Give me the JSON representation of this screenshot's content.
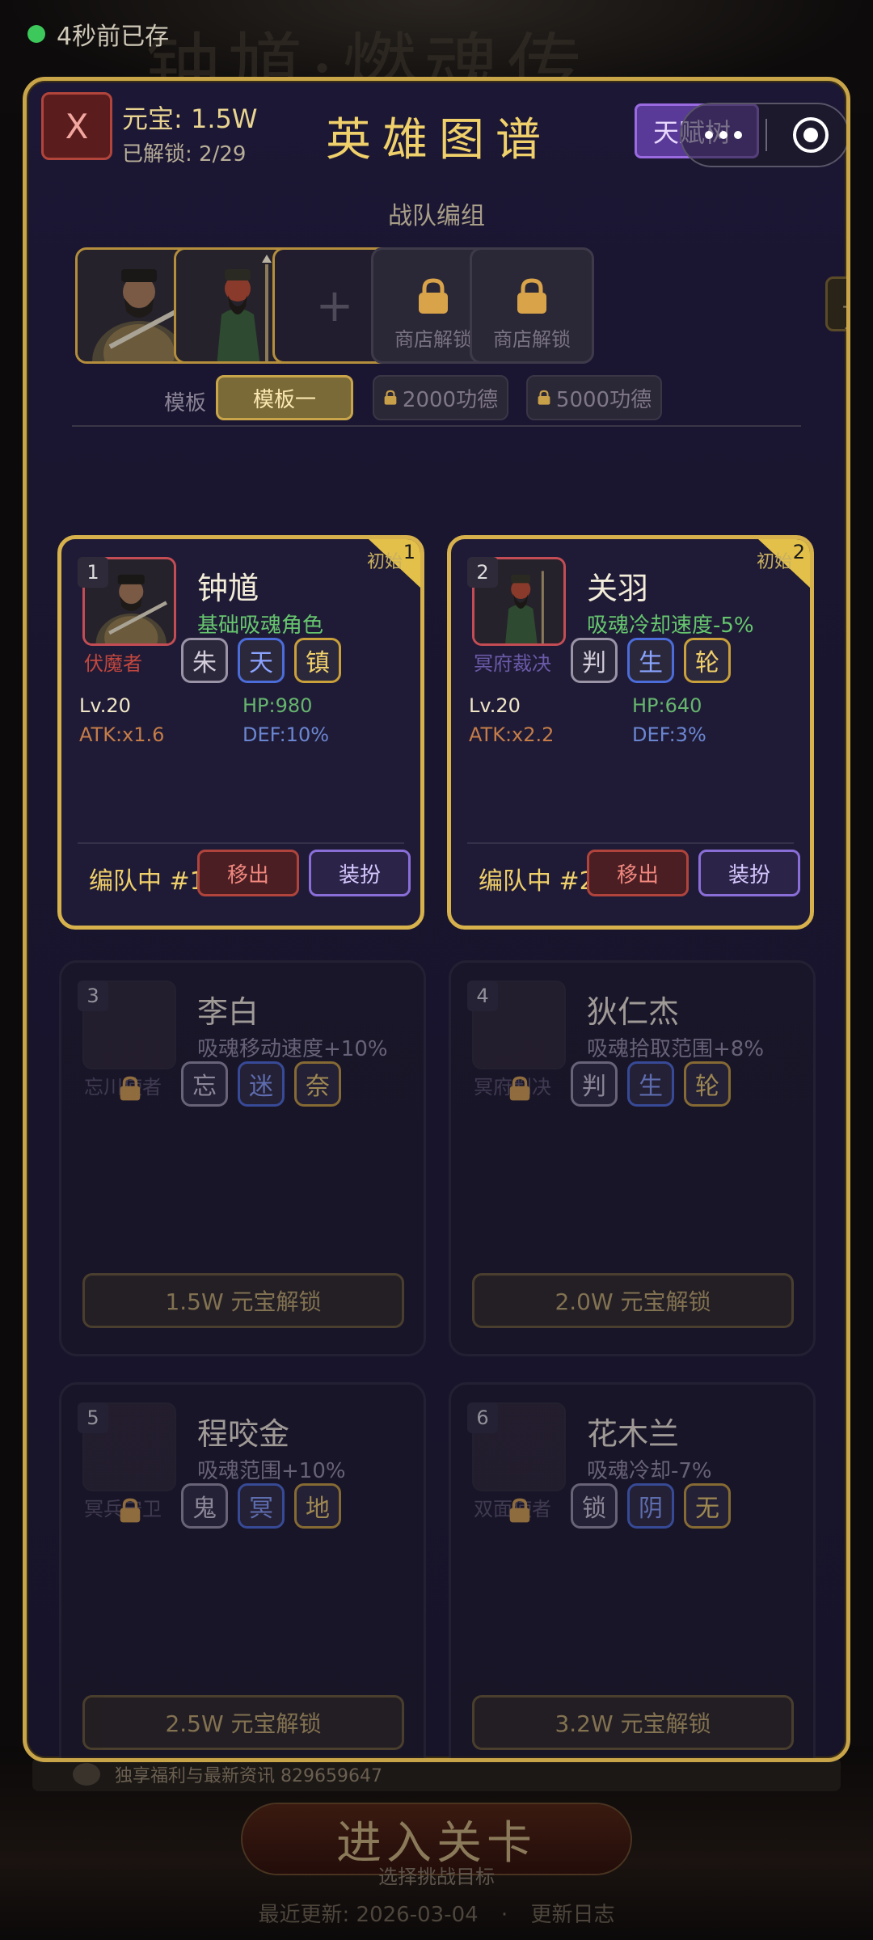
{
  "status": {
    "text": "4秒前已存"
  },
  "background": {
    "title": "钟馗·燃魂传",
    "notice": "独享福利与最新资讯 829659647",
    "enter_button": "进入关卡",
    "enter_sub": "选择挑战目标",
    "update_label": "最近更新: 2026-03-04",
    "update_sep": "·",
    "changelog": "更新日志"
  },
  "header": {
    "close_label": "X",
    "currency": "元宝: 1.5W",
    "unlocked": "已解锁: 2/29",
    "title": "英雄图谱",
    "talent_label": "天赋树"
  },
  "team": {
    "title": "战队编组",
    "slot_locked_label": "商店解锁",
    "slot_empty_label": "+",
    "side_label": "一键",
    "template_label": "模板",
    "templates": [
      {
        "label": "模板一",
        "active": true
      },
      {
        "label": "2000功德",
        "active": false
      },
      {
        "label": "5000功德",
        "active": false
      }
    ]
  },
  "heroes": [
    {
      "index": "1",
      "name": "钟馗",
      "skill": "基础吸魂角色",
      "role": "伏魔者",
      "tags": [
        "朱",
        "天",
        "镇"
      ],
      "tag_styles": [
        "gray",
        "blue",
        "gold"
      ],
      "level": "Lv.20",
      "hp": "HP:980",
      "atk": "ATK:x1.6",
      "def": "DEF:10%",
      "badge": "初始",
      "corner": "1",
      "team_status": "编队中 #1",
      "remove_label": "移出",
      "equip_label": "装扮",
      "unlocked": true
    },
    {
      "index": "2",
      "name": "关羽",
      "skill": "吸魂冷却速度-5%",
      "role": "冥府裁决",
      "tags": [
        "判",
        "生",
        "轮"
      ],
      "tag_styles": [
        "gray",
        "blue",
        "gold"
      ],
      "level": "Lv.20",
      "hp": "HP:640",
      "atk": "ATK:x2.2",
      "def": "DEF:3%",
      "badge": "初始",
      "corner": "2",
      "team_status": "编队中 #2",
      "remove_label": "移出",
      "equip_label": "装扮",
      "unlocked": true
    },
    {
      "index": "3",
      "name": "李白",
      "skill": "吸魂移动速度+10%",
      "role": "忘川使者",
      "tags": [
        "忘",
        "迷",
        "奈"
      ],
      "tag_styles": [
        "gray",
        "blue",
        "gold"
      ],
      "unlock_label": "1.5W 元宝解锁",
      "unlocked": false
    },
    {
      "index": "4",
      "name": "狄仁杰",
      "skill": "吸魂拾取范围+8%",
      "role": "冥府判决",
      "tags": [
        "判",
        "生",
        "轮"
      ],
      "tag_styles": [
        "gray",
        "blue",
        "gold"
      ],
      "unlock_label": "2.0W 元宝解锁",
      "unlocked": false
    },
    {
      "index": "5",
      "name": "程咬金",
      "skill": "吸魂范围+10%",
      "role": "冥兵守卫",
      "tags": [
        "鬼",
        "冥",
        "地"
      ],
      "tag_styles": [
        "gray",
        "blue",
        "gold"
      ],
      "unlock_label": "2.5W 元宝解锁",
      "unlocked": false
    },
    {
      "index": "6",
      "name": "花木兰",
      "skill": "吸魂冷却-7%",
      "role": "双面使者",
      "tags": [
        "锁",
        "阴",
        "无"
      ],
      "tag_styles": [
        "gray",
        "blue",
        "gold"
      ],
      "unlock_label": "3.2W 元宝解锁",
      "unlocked": false
    }
  ],
  "colors": {
    "accent_gold": "#d7b14c",
    "panel_bg": "#1b1734",
    "danger": "#b0443c",
    "purple": "#8a6ed8"
  },
  "icons": {
    "lock": "lock-icon",
    "more": "more-dots-icon",
    "target": "target-icon"
  }
}
